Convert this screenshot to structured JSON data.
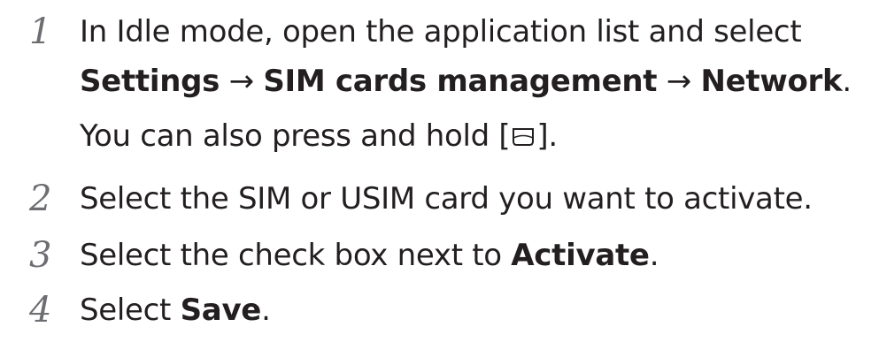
{
  "steps": [
    {
      "number": "1",
      "text_before": "In Idle mode, open the application list and select",
      "path": [
        "Settings",
        "SIM cards management",
        "Network"
      ],
      "arrow": "→",
      "end_punct": ".",
      "note_before": "You can also press and hold [",
      "note_after": "].",
      "note_icon": "menu-key-icon"
    },
    {
      "number": "2",
      "text": "Select the SIM or USIM card you want to activate."
    },
    {
      "number": "3",
      "text_before": "Select the check box next to ",
      "bold": "Activate",
      "end_punct": "."
    },
    {
      "number": "4",
      "text_before": "Select ",
      "bold": "Save",
      "end_punct": "."
    }
  ]
}
